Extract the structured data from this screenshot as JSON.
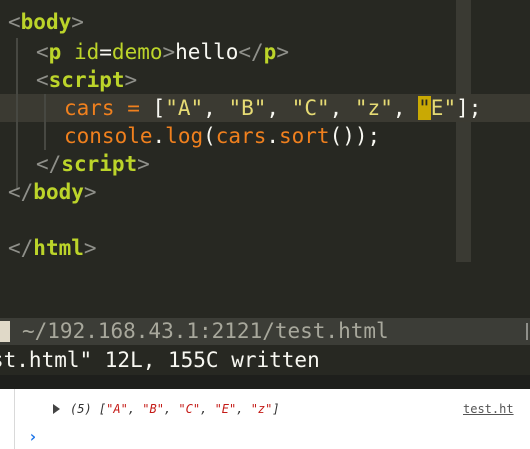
{
  "editor": {
    "lines": [
      {
        "parts": [
          [
            "c-br",
            "<"
          ],
          [
            "c-tag",
            "body"
          ],
          [
            "c-br",
            ">"
          ]
        ]
      },
      {
        "parts": [
          [
            "c-br",
            "<"
          ],
          [
            "c-tag",
            "p"
          ],
          [
            "c-txt",
            " "
          ],
          [
            "c-attr",
            "id"
          ],
          [
            "c-txt",
            "="
          ],
          [
            "c-attr",
            "demo"
          ],
          [
            "c-br",
            ">"
          ],
          [
            "c-txt",
            "hello"
          ],
          [
            "c-br",
            "</"
          ],
          [
            "c-tag",
            "p"
          ],
          [
            "c-br",
            ">"
          ]
        ]
      },
      {
        "parts": [
          [
            "c-br",
            "<"
          ],
          [
            "c-tag",
            "script"
          ],
          [
            "c-br",
            ">"
          ]
        ]
      },
      {
        "parts": [
          [
            "c-var",
            "cars"
          ],
          [
            "c-txt",
            " "
          ],
          [
            "c-op",
            "="
          ],
          [
            "c-txt",
            " "
          ],
          [
            "c-pn",
            "["
          ],
          [
            "c-str",
            "\"A\""
          ],
          [
            "c-pn",
            ", "
          ],
          [
            "c-str",
            "\"B\""
          ],
          [
            "c-pn",
            ", "
          ],
          [
            "c-str",
            "\"C\""
          ],
          [
            "c-pn",
            ", "
          ],
          [
            "c-str",
            "\"z\""
          ],
          [
            "c-pn",
            ", "
          ],
          [
            "cursor",
            "\""
          ],
          [
            "c-str",
            "E\""
          ],
          [
            "c-pn",
            "];"
          ]
        ]
      },
      {
        "parts": [
          [
            "c-var",
            "console"
          ],
          [
            "c-pn",
            "."
          ],
          [
            "c-var",
            "log"
          ],
          [
            "c-pn",
            "("
          ],
          [
            "c-var",
            "cars"
          ],
          [
            "c-pn",
            "."
          ],
          [
            "c-var",
            "sort"
          ],
          [
            "c-pn",
            "());"
          ]
        ]
      },
      {
        "parts": [
          [
            "c-br",
            "</"
          ],
          [
            "c-tag",
            "script"
          ],
          [
            "c-br",
            ">"
          ]
        ]
      },
      {
        "parts": [
          [
            "c-br",
            "</"
          ],
          [
            "c-tag",
            "body"
          ],
          [
            "c-br",
            ">"
          ]
        ]
      },
      {
        "parts": []
      },
      {
        "parts": [
          [
            "c-br",
            "</"
          ],
          [
            "c-tag",
            "html"
          ],
          [
            "c-br",
            ">"
          ]
        ]
      }
    ]
  },
  "statusline": {
    "file_path": "~/192.168.43.1:2121/test.html"
  },
  "cmdline": {
    "message": "st.html\" 12L, 155C written"
  },
  "console": {
    "log_count": "(5)",
    "log_items": [
      "\"A\"",
      "\"B\"",
      "\"C\"",
      "\"E\"",
      "\"z\""
    ],
    "source_link": "test.ht",
    "prompt_symbol": "›"
  },
  "colors": {
    "editor_bg": "#272822",
    "tag": "#bcd42a",
    "string": "#e6db74",
    "identifier": "#f0801e",
    "cursor": "#c9a904",
    "console_string": "#c41a16",
    "prompt": "#1a73e8"
  }
}
